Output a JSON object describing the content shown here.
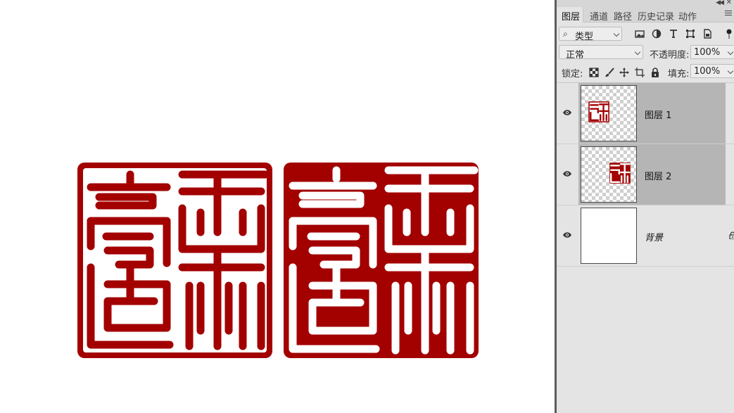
{
  "panel": {
    "tabs": [
      {
        "label": "图层"
      },
      {
        "label": "通道"
      },
      {
        "label": "路径"
      },
      {
        "label": "历史记录"
      },
      {
        "label": "动作"
      }
    ],
    "filter": {
      "label": "类型"
    },
    "blend_mode": "正常",
    "opacity_label": "不透明度:",
    "opacity_value": "100%",
    "lock_label": "锁定:",
    "fill_label": "填充:",
    "fill_value": "100%",
    "layers": [
      {
        "name": "图层 1",
        "selected": true
      },
      {
        "name": "图层 2",
        "selected": true
      },
      {
        "name": "背景",
        "selected": false,
        "locked": true
      }
    ]
  },
  "colors": {
    "seal_red": "#a30000",
    "panel_bg": "#e4e4e4",
    "selected_layer_bg": "#b5b5b5"
  },
  "icons": [
    "collapse-icon",
    "close-icon",
    "panel-menu-icon",
    "search-icon",
    "image-filter-icon",
    "adjustment-filter-icon",
    "type-filter-icon",
    "shape-filter-icon",
    "smart-object-filter-icon",
    "filter-toggle-icon",
    "lock-transparent-icon",
    "lock-paint-icon",
    "lock-move-icon",
    "lock-artboard-icon",
    "lock-all-icon",
    "eye-icon",
    "lock-icon"
  ]
}
